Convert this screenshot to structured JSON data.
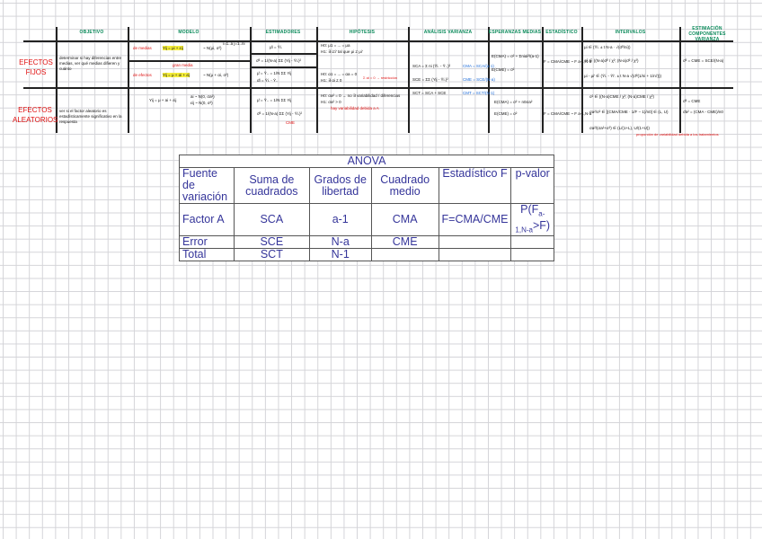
{
  "notes": {
    "headers": [
      "OBJETIVO",
      "MODELO",
      "ESTIMADORES",
      "HIPÓTESIS",
      "ANÁLISIS VARIANZA",
      "ESPERANZAS MEDIAS",
      "ESTADÍSTICO",
      "INTERVALOS",
      "ESTIMACIÓN COMPONENTES VARIANZA"
    ],
    "rows": [
      {
        "label": "EFECTOS FIJOS",
        "objetivo": "determinar si hay diferencias entre medias, ver qué medias difieren y cuánto",
        "modelo_medias_label": "de medias",
        "modelo_medias": "Yij = μi + εij",
        "modelo_medias_dist": "~ N(μi, σ²)",
        "modelo_medias_idx": "i=1..a  j=1..ni",
        "modelo_efectos_note": "gran media",
        "modelo_efectos_label": "de efectos",
        "modelo_efectos": "Yij = μ + αi + εij",
        "modelo_efectos_dist": "~ N(μ + αi, σ²)",
        "est_1": "μ̂i = Ȳi.",
        "est_2": "σ̂² = 1/(N-a) ΣΣ (Yij - Ȳi.)²",
        "est_3": "μ̂ = Ȳ.. = 1/N ΣΣ Yij",
        "est_4": "α̂i = Ȳi. - Ȳ..",
        "hip_1": "H0: μ1 = ... = μa",
        "hip_2": "H1: ∃ i≠i' tal que μi ≠ μi'",
        "hip_3": "H0: α1 = ... = αa = 0",
        "hip_4": "H1: ∃ αi ≠ 0",
        "hip_5": "Σ αi = 0 → restricción",
        "anova_1": "SCA = Σ ni (Ȳi. - Ȳ..)²",
        "anova_2": "SCE = ΣΣ (Yij - Ȳi.)²",
        "anova_3": "SCT = SCA + SCE",
        "anova_cm1": "CMA = SCA/(a-1)",
        "anova_cm2": "CME = SCE/(N-a)",
        "anova_cm3": "CMT = SCT/(N-1)",
        "esp_1": "E(CMA) = σ² + Σniαi²/(a-1)",
        "esp_2": "E(CME) = σ²",
        "estad": "F = CMA/CME ~ F a-1,N-a",
        "int_1": "μi ∈ (Ȳi. ± t N-a · √(σ̂²/ni))",
        "int_2": "σ² ∈ ((N-a)σ̂² / χ²; (N-a)σ̂² / χ²)",
        "int_3": "μi - μi' ∈ (Ȳi. - Ȳi'. ± t N-a √(σ̂²(1/ni + 1/ni')))",
        "comp_1": "σ̂² = CME = SCE/(N-a)"
      },
      {
        "label": "EFECTOS ALEATORIOS",
        "objetivo": "ver si el factor aleatorio es estadísticamente significativo en la respuesta",
        "modelo": "Yij = μ + ai + εij",
        "modelo_dist_1": "ai ~ N(0, σa²)",
        "modelo_dist_2": "εij ~ N(0, σ²)",
        "est_1": "μ̂ = Ȳ.. = 1/N ΣΣ Yij",
        "est_2": "σ̂² = 1/(N-a) ΣΣ (Yij - Ȳi.)²",
        "est_note": "CME",
        "hip_1": "H0: σa² = 0 → no ∃ variabilidad / diferencias",
        "hip_2": "H1: σa² > 0",
        "hip_note": "hay variabilidad debida a A",
        "esp_1": "E(CMA) = σ² + n0σa²",
        "esp_2": "E(CME) = σ²",
        "estad": "F = CMA/CME ~ F a-1,N-a",
        "int_1": "σ² ∈ ((N-a)CME / χ²; (N-a)CME / χ²)",
        "int_2": "σa²/σ² ∈ [(CMA/CME · 1/F − 1)/n0] ∈ (L, U)",
        "int_3": "σa²/(σa²+σ²) ∈ (L/(1+L), U/(1+U))",
        "int_note": "proporción de variabilidad debida a los tratamientos",
        "comp_1": "σ̂² = CME",
        "comp_2": "σ̂a² = (CMA - CME)/n0"
      }
    ]
  },
  "anova": {
    "title": "ANOVA",
    "headers": [
      "Fuente de variación",
      "Suma de cuadrados",
      "Grados de libertad",
      "Cuadrado medio",
      "Estadístico F",
      "p-valor"
    ],
    "rows": [
      [
        "Factor A",
        "SCA",
        "a-1",
        "CMA",
        "F=CMA/CME",
        "P(F"
      ],
      [
        "Error",
        "SCE",
        "N-a",
        "CME",
        "",
        ""
      ],
      [
        "Total",
        "SCT",
        "N-1",
        "",
        "",
        ""
      ]
    ],
    "pvalue_sub": "a-1,N-a",
    "pvalue_tail": ">F)"
  }
}
